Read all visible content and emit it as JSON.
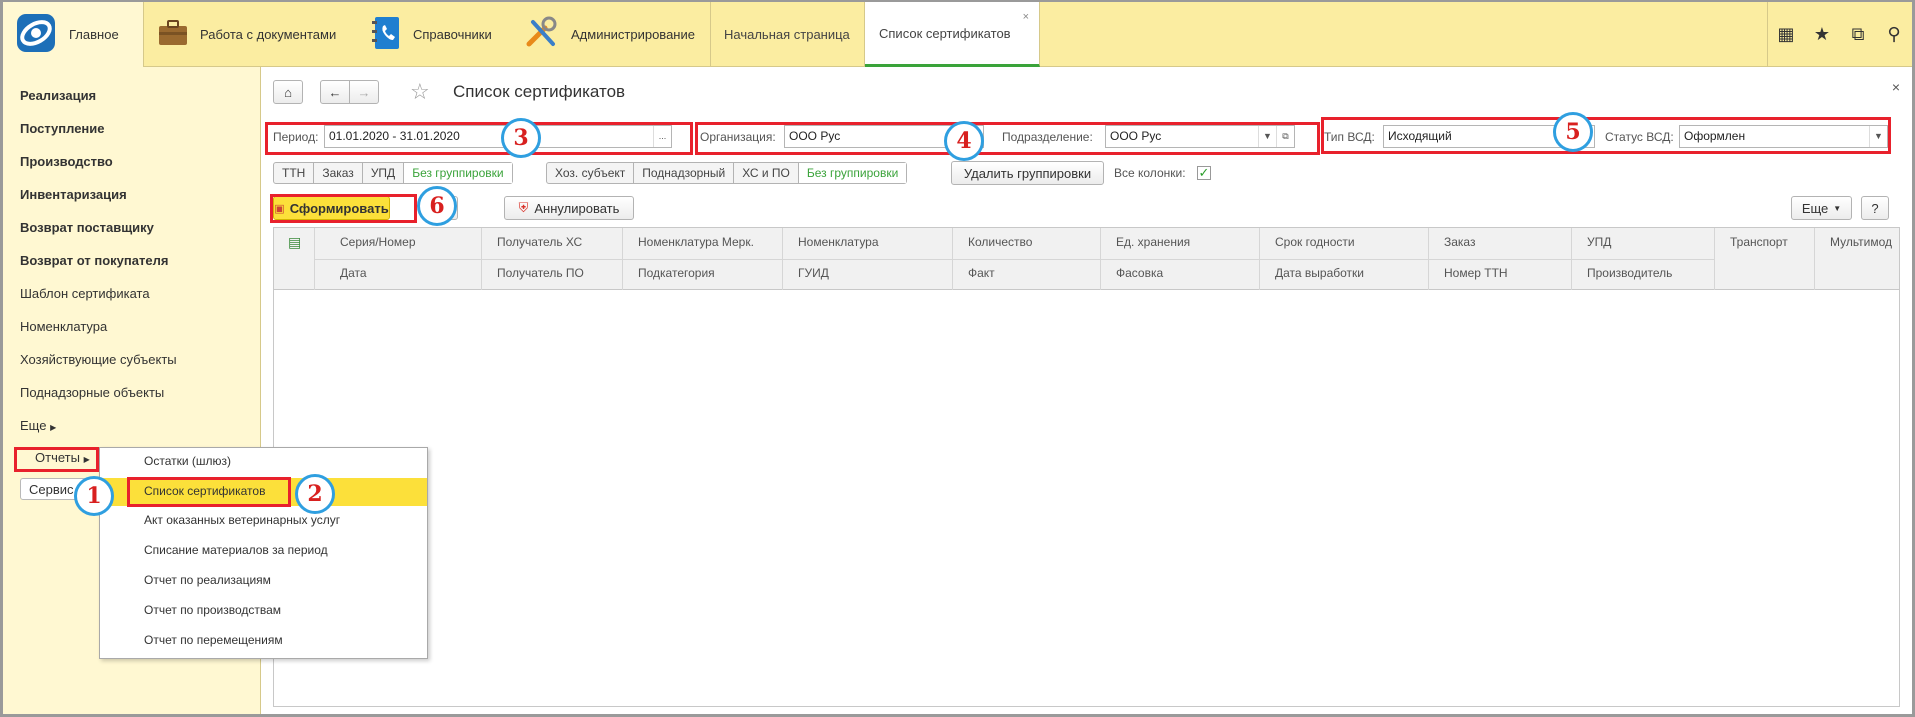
{
  "topbar": {
    "home": "Главное",
    "sections": [
      "Работа с документами",
      "Справочники",
      "Администрирование"
    ],
    "open_tabs": [
      "Начальная страница",
      "Список сертификатов"
    ],
    "tab_close": "×"
  },
  "sidebar": {
    "items": [
      "Реализация",
      "Поступление",
      "Производство",
      "Инвентаризация",
      "Возврат поставщику",
      "Возврат от покупателя",
      "Шаблон сертификата",
      "Номенклатура",
      "Хозяйствующие субъекты",
      "Поднадзорные объекты",
      "Еще",
      "Отчеты"
    ],
    "service_button": "Сервис"
  },
  "page": {
    "title": "Список сертификатов",
    "close": "×"
  },
  "filters": {
    "period_label": "Период:",
    "period_value": "01.01.2020 - 31.01.2020",
    "period_btn": "...",
    "org_label": "Организация:",
    "org_value": "ООО  Рус",
    "dept_label": "Подразделение:",
    "dept_value": "ООО Рус",
    "vsd_type_label": "Тип ВСД:",
    "vsd_type_value": "Исходящий",
    "vsd_status_label": "Статус ВСД:",
    "vsd_status_value": "Оформлен"
  },
  "groups": {
    "docs": [
      "ТТН",
      "Заказ",
      "УПД",
      "Без группировки"
    ],
    "subjects": [
      "Хоз. субъект",
      "Поднадзорный",
      "ХС и ПО",
      "Без группировки"
    ],
    "delete_groups": "Удалить группировки",
    "all_columns": "Все колонки:",
    "all_columns_checked": true
  },
  "toolbar": {
    "generate": "Сформировать",
    "annul": "Аннулировать",
    "more": "Еще",
    "help": "?"
  },
  "table": {
    "row1": [
      "Серия/Номер",
      "Получатель ХС",
      "Номенклатура Мерк.",
      "Номенклатура",
      "Количество",
      "Ед. хранения",
      "Срок годности",
      "Заказ",
      "УПД",
      "Транспорт",
      "Мультимод"
    ],
    "row2": [
      "Дата",
      "Получатель ПО",
      "Подкатегория",
      "ГУИД",
      "Факт",
      "Фасовка",
      "Дата выработки",
      "Номер ТТН",
      "Производитель"
    ]
  },
  "popup_menu": {
    "items": [
      "Остатки (шлюз)",
      "Список сертификатов",
      "Акт оказанных ветеринарных услуг",
      "Списание материалов за период",
      "Отчет по реализациям",
      "Отчет по производствам",
      "Отчет по перемещениям"
    ],
    "highlighted": 1
  },
  "annotations": [
    "1",
    "2",
    "3",
    "4",
    "5",
    "6"
  ],
  "colors": {
    "annotation_red": "#e8212c",
    "annotation_blue": "#2f9fe0",
    "menu_highlight": "#fce03a",
    "topbar_bg": "#fbeda1",
    "sidebar_bg": "#fff8d2",
    "green_text": "#3aa33a"
  }
}
